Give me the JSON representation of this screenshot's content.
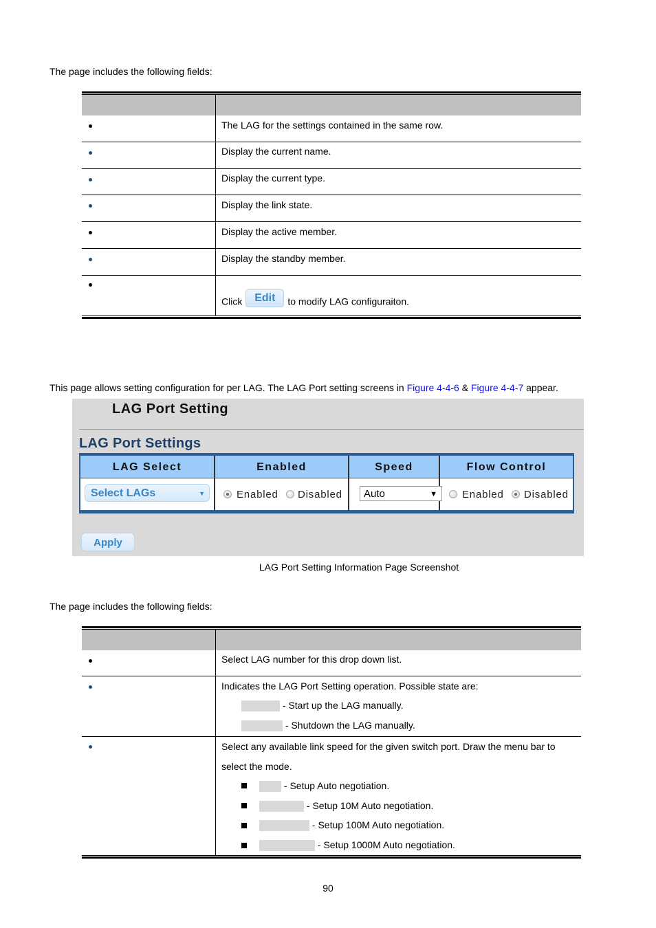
{
  "intro1": "The page includes the following fields:",
  "table1": {
    "rows": [
      {
        "desc": "The LAG for the settings contained in the same row."
      },
      {
        "desc": "Display the current name."
      },
      {
        "desc": "Display the current type."
      },
      {
        "desc": "Display the link state."
      },
      {
        "desc": "Display the active member."
      },
      {
        "desc": "Display the standby member."
      },
      {
        "desc_prefix": "Click",
        "button": "Edit",
        "desc_suffix": "to modify LAG configuraiton."
      }
    ]
  },
  "intro2": {
    "text_a": "This page allows setting configuration for per LAG. The LAG Port setting screens in ",
    "link1": "Figure 4-4-6",
    "text_b": " & ",
    "link2": "Figure 4-4-7",
    "text_c": " appear."
  },
  "screenshot": {
    "title": "LAG Port Setting",
    "section": "LAG Port Settings",
    "columns": [
      "LAG Select",
      "Enabled",
      "Speed",
      "Flow Control"
    ],
    "lag_select": "Select LAGs",
    "enabled_options": [
      "Enabled",
      "Disabled"
    ],
    "enabled_selected": "Enabled",
    "speed_value": "Auto",
    "flow_options": [
      "Enabled",
      "Disabled"
    ],
    "flow_selected": "Disabled",
    "apply": "Apply"
  },
  "caption": "LAG Port Setting Information Page Screenshot",
  "intro3": "The page includes the following fields:",
  "table2": {
    "row1": "Select LAG number for this drop down list.",
    "row2": {
      "desc": "Indicates the LAG Port Setting operation. Possible state are:",
      "items": [
        "- Start up the LAG manually.",
        "- Shutdown the LAG manually."
      ]
    },
    "row3": {
      "desc1": "Select any available link speed for the given switch port. Draw the menu bar to",
      "desc2": "select the mode.",
      "items": [
        "- Setup Auto negotiation.",
        "- Setup 10M Auto negotiation.",
        "- Setup 100M Auto negotiation.",
        "- Setup 1000M Auto negotiation."
      ]
    }
  },
  "page_number": "90"
}
